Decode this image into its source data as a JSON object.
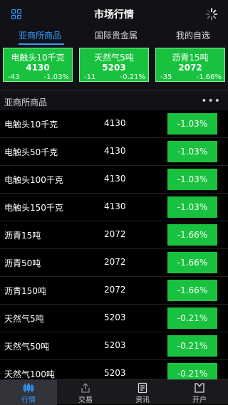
{
  "header": {
    "title": "市场行情",
    "left_icon": "grid-icon",
    "right_icon": "loading-spinner-icon"
  },
  "tabs": [
    {
      "label": "亚商所商品",
      "active": true
    },
    {
      "label": "国际贵金属",
      "active": false
    },
    {
      "label": "我的自选",
      "active": false
    }
  ],
  "cards": [
    {
      "name": "电触头10千克",
      "price": "4130",
      "change": "-43",
      "percent": "-1.03%"
    },
    {
      "name": "天然气5吨",
      "price": "5203",
      "change": "-11",
      "percent": "-0.21%"
    },
    {
      "name": "沥青15吨",
      "price": "2072",
      "change": "-35",
      "percent": "-1.66%"
    }
  ],
  "section": {
    "title": "亚商所商品",
    "more_icon": "more-icon",
    "more_text": "•••"
  },
  "rows": [
    {
      "name": "电触头10千克",
      "price": "4130",
      "percent": "-1.03%"
    },
    {
      "name": "电触头50千克",
      "price": "4130",
      "percent": "-1.03%"
    },
    {
      "name": "电触头100千克",
      "price": "4130",
      "percent": "-1.03%"
    },
    {
      "name": "电触头150千克",
      "price": "4130",
      "percent": "-1.03%"
    },
    {
      "name": "沥青15吨",
      "price": "2072",
      "percent": "-1.66%"
    },
    {
      "name": "沥青50吨",
      "price": "2072",
      "percent": "-1.66%"
    },
    {
      "name": "沥青150吨",
      "price": "2072",
      "percent": "-1.66%"
    },
    {
      "name": "天然气5吨",
      "price": "5203",
      "percent": "-0.21%"
    },
    {
      "name": "天然气50吨",
      "price": "5203",
      "percent": "-0.21%"
    },
    {
      "name": "天然气100吨",
      "price": "5203",
      "percent": "-0.21%"
    }
  ],
  "tabbar": [
    {
      "label": "行情",
      "icon": "chart-icon",
      "active": true
    },
    {
      "label": "交易",
      "icon": "trade-icon",
      "active": false
    },
    {
      "label": "资讯",
      "icon": "news-icon",
      "active": false
    },
    {
      "label": "开户",
      "icon": "account-icon",
      "active": false
    }
  ],
  "colors": {
    "accent_blue": "#2f9bff",
    "change_green": "#19c23e",
    "background": "#000000",
    "bar_background": "#121216"
  }
}
